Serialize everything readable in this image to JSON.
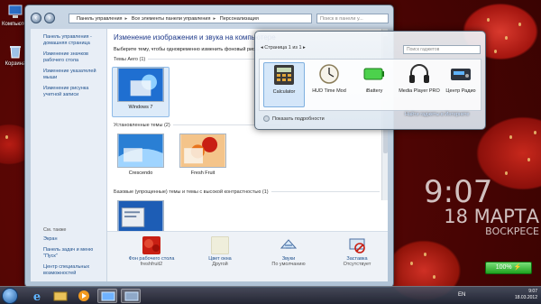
{
  "desktop": {
    "icons": [
      {
        "label": "Компьютер",
        "icon": "computer-icon"
      },
      {
        "label": "Корзина",
        "icon": "recycle-bin-icon"
      }
    ]
  },
  "explorer": {
    "breadcrumb": [
      "Панель управления",
      "Все элементы панели управления",
      "Персонализация"
    ],
    "search_placeholder": "Поиск в панели у...",
    "sidebar": {
      "links": [
        "Панель управления - домашняя страница",
        "Изменение значков рабочего стола",
        "Изменение указателей мыши",
        "Изменение рисунка учетной записи"
      ],
      "see_also_title": "См. также",
      "see_also": [
        "Экран",
        "Панель задач и меню \"Пуск\"",
        "Центр специальных возможностей"
      ]
    },
    "heading": "Изменение изображения и звука на компьютере",
    "subtext": "Выберите тему, чтобы одновременно изменить фоновый рис...",
    "groups": [
      {
        "title": "Темы Aero (1)",
        "themes": [
          "Windows 7"
        ]
      },
      {
        "title": "Установленные темы (2)",
        "themes": [
          "Crescendo",
          "Fresh Fruit"
        ]
      },
      {
        "title": "Базовые (упрощенные) темы и темы с высокой контрастностью (1)",
        "themes": [
          ""
        ]
      }
    ],
    "bottom": [
      {
        "label": "Фон рабочего стола",
        "value": "freshfruit2",
        "icon": "wallpaper-icon"
      },
      {
        "label": "Цвет окна",
        "value": "Другой",
        "icon": "window-color-icon"
      },
      {
        "label": "Звуки",
        "value": "По умолчанию",
        "icon": "sounds-icon"
      },
      {
        "label": "Заставка",
        "value": "Отсутствует",
        "icon": "screensaver-icon"
      }
    ]
  },
  "gadgets": {
    "page_label": "Страница 1 из 1",
    "search_placeholder": "Поиск гаджетов",
    "items": [
      {
        "label": "Calculator",
        "icon": "calculator-icon"
      },
      {
        "label": "HUD Time Mod",
        "icon": "clock-icon"
      },
      {
        "label": "iBattery",
        "icon": "battery-icon"
      },
      {
        "label": "Media Player PRO",
        "icon": "headphones-icon"
      },
      {
        "label": "Центр Радио",
        "icon": "radio-icon"
      }
    ],
    "details_label": "Показать подробности",
    "online_link": "Найти гаджеты в Интернете"
  },
  "clock": {
    "time": "9:07",
    "date": "18 МАРТА",
    "weekday": "ВОСКРЕСЕ"
  },
  "battery": {
    "percent_label": "100%",
    "level": 1.0
  },
  "taskbar": {
    "lang": "EN",
    "time": "9:07",
    "date": "18.03.2012"
  },
  "colors": {
    "accent": "#1f3a8a",
    "link": "#1d4f8c",
    "battery": "#1fa31f"
  }
}
